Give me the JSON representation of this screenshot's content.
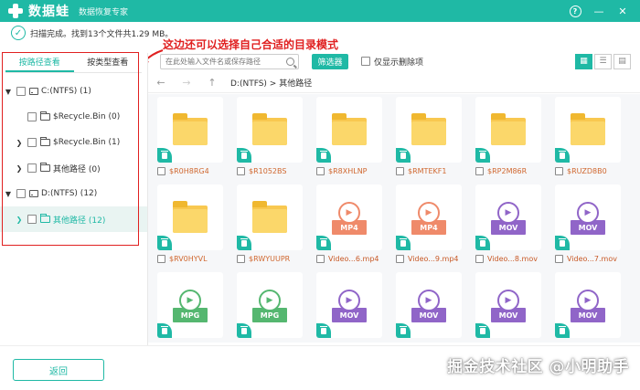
{
  "app": {
    "name": "数据蛙",
    "subtitle": "数据恢复专家"
  },
  "status": {
    "text": "扫描完成。找到13个文件共1.29 MB。"
  },
  "annotation": {
    "text": "这边还可以选择自己合适的目录模式"
  },
  "tabs": {
    "by_path": "按路径查看",
    "by_type": "按类型查看"
  },
  "tree": [
    {
      "label": "C:(NTFS) (1)"
    },
    {
      "label": "$Recycle.Bin (0)"
    },
    {
      "label": "$Recycle.Bin (1)"
    },
    {
      "label": "其他路径 (0)"
    },
    {
      "label": "D:(NTFS) (12)"
    },
    {
      "label": "其他路径 (12)"
    }
  ],
  "toolbar": {
    "search_placeholder": "在此处输入文件名或保存路径",
    "filter_label": "筛选器",
    "only_deleted": "仅显示删除项"
  },
  "breadcrumb": "D:(NTFS)  >  其他路径",
  "files": [
    {
      "name": "$R0H8RG4",
      "kind": "folder"
    },
    {
      "name": "$R1052BS",
      "kind": "folder"
    },
    {
      "name": "$R8XHLNP",
      "kind": "folder"
    },
    {
      "name": "$RMTEKF1",
      "kind": "folder"
    },
    {
      "name": "$RP2M86R",
      "kind": "folder"
    },
    {
      "name": "$RUZD8B0",
      "kind": "folder"
    },
    {
      "name": "$RV0HYVL",
      "kind": "folder"
    },
    {
      "name": "$RWYUUPR",
      "kind": "folder"
    },
    {
      "name": "Video...6.mp4",
      "kind": "MP4"
    },
    {
      "name": "Video...9.mp4",
      "kind": "MP4"
    },
    {
      "name": "Video...8.mov",
      "kind": "MOV"
    },
    {
      "name": "Video...7.mov",
      "kind": "MOV"
    },
    {
      "name": "",
      "kind": "MPG"
    },
    {
      "name": "",
      "kind": "MPG"
    },
    {
      "name": "",
      "kind": "MOV"
    },
    {
      "name": "",
      "kind": "MOV"
    },
    {
      "name": "",
      "kind": "MOV"
    },
    {
      "name": "",
      "kind": "MOV"
    }
  ],
  "bottom": {
    "back_label": "返回",
    "watermark": "掘金技术社区 @小明助手"
  },
  "colors": {
    "accent": "#1fb9a5",
    "annotation": "#e02020"
  }
}
